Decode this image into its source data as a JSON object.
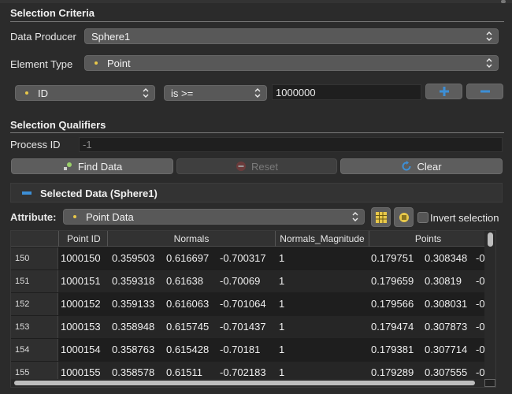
{
  "selection_criteria": {
    "title": "Selection Criteria",
    "data_producer_label": "Data Producer",
    "data_producer_value": "Sphere1",
    "element_type_label": "Element Type",
    "element_type_value": "Point",
    "query_field_value": "ID",
    "query_operator_value": "is >=",
    "query_value": "1000000"
  },
  "selection_qualifiers": {
    "title": "Selection Qualifiers",
    "process_id_label": "Process ID",
    "process_id_value": "-1"
  },
  "buttons": {
    "find_data": "Find Data",
    "reset": "Reset",
    "clear": "Clear"
  },
  "selected_data": {
    "title": "Selected Data (Sphere1)",
    "attribute_label": "Attribute:",
    "attribute_value": "Point Data",
    "invert_selection_label": "Invert selection"
  },
  "table": {
    "headers": [
      "Point ID",
      "Normals",
      "Normals_Magnitude",
      "Points"
    ],
    "rows": [
      {
        "row": "150",
        "cells": [
          "1000150",
          "0.359503",
          "0.616697",
          "-0.700317",
          "1",
          "0.179751",
          "0.308348",
          "-0"
        ]
      },
      {
        "row": "151",
        "cells": [
          "1000151",
          "0.359318",
          "0.61638",
          "-0.70069",
          "1",
          "0.179659",
          "0.30819",
          "-0"
        ]
      },
      {
        "row": "152",
        "cells": [
          "1000152",
          "0.359133",
          "0.616063",
          "-0.701064",
          "1",
          "0.179566",
          "0.308031",
          "-0"
        ]
      },
      {
        "row": "153",
        "cells": [
          "1000153",
          "0.358948",
          "0.615745",
          "-0.701437",
          "1",
          "0.179474",
          "0.307873",
          "-0"
        ]
      },
      {
        "row": "154",
        "cells": [
          "1000154",
          "0.358763",
          "0.615428",
          "-0.70181",
          "1",
          "0.179381",
          "0.307714",
          "-0"
        ]
      },
      {
        "row": "155",
        "cells": [
          "1000155",
          "0.358578",
          "0.61511",
          "-0.702183",
          "1",
          "0.179289",
          "0.307555",
          "-0"
        ]
      }
    ]
  },
  "colors": {
    "accent_blue": "#3d8fd6",
    "point_dot": "#e8c84a"
  }
}
